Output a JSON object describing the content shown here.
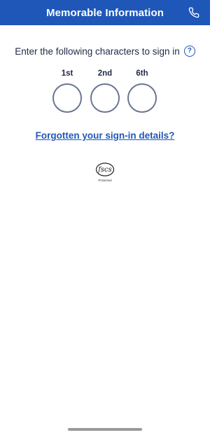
{
  "header": {
    "title": "Memorable Information",
    "phone_icon": "phone-icon"
  },
  "instruction": {
    "text": "Enter the following characters to sign in",
    "help_icon_glyph": "?"
  },
  "characters": [
    {
      "label": "1st",
      "value": ""
    },
    {
      "label": "2nd",
      "value": ""
    },
    {
      "label": "6th",
      "value": ""
    }
  ],
  "forgotten_link": "Forgotten your sign-in details?",
  "fscs": {
    "logo_text": "fscs",
    "caption": "Protected"
  },
  "colors": {
    "header_bg": "#1f57b8",
    "link": "#1f57b8",
    "circle_border": "#6a7590"
  }
}
